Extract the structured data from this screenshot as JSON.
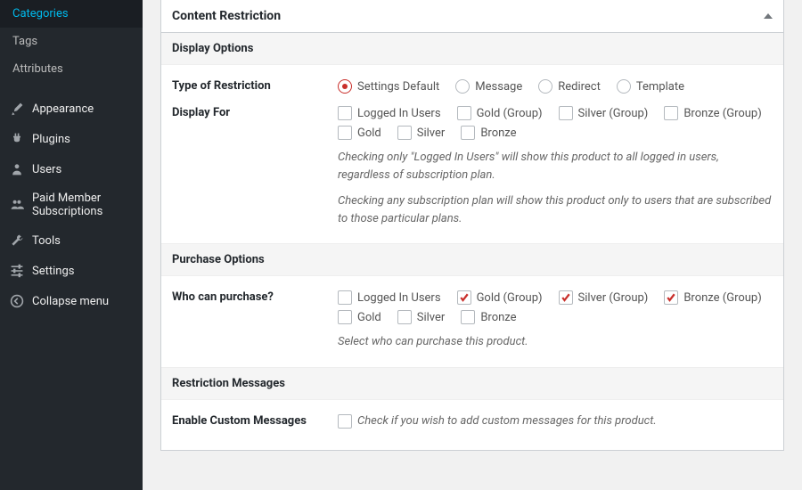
{
  "sidebar": {
    "items": [
      {
        "label": "Categories",
        "icon": null
      },
      {
        "label": "Tags",
        "icon": null
      },
      {
        "label": "Attributes",
        "icon": null
      },
      {
        "label": "Appearance",
        "icon": "brush"
      },
      {
        "label": "Plugins",
        "icon": "plug"
      },
      {
        "label": "Users",
        "icon": "user"
      },
      {
        "label": "Paid Member Subscriptions",
        "icon": "members"
      },
      {
        "label": "Tools",
        "icon": "wrench"
      },
      {
        "label": "Settings",
        "icon": "settings"
      },
      {
        "label": "Collapse menu",
        "icon": "collapse"
      }
    ]
  },
  "metabox": {
    "title": "Content Restriction",
    "sections": {
      "display_options": {
        "heading": "Display Options",
        "type_of_restriction": {
          "label": "Type of Restriction",
          "options": [
            "Settings Default",
            "Message",
            "Redirect",
            "Template"
          ],
          "selected": "Settings Default"
        },
        "display_for": {
          "label": "Display For",
          "options": [
            {
              "label": "Logged In Users",
              "checked": false
            },
            {
              "label": "Gold (Group)",
              "checked": false
            },
            {
              "label": "Silver (Group)",
              "checked": false
            },
            {
              "label": "Bronze (Group)",
              "checked": false
            },
            {
              "label": "Gold",
              "checked": false
            },
            {
              "label": "Silver",
              "checked": false
            },
            {
              "label": "Bronze",
              "checked": false
            }
          ],
          "help1": "Checking only \"Logged In Users\" will show this product to all logged in users, regardless of subscription plan.",
          "help2": "Checking any subscription plan will show this product only to users that are subscribed to those particular plans."
        }
      },
      "purchase_options": {
        "heading": "Purchase Options",
        "who_can_purchase": {
          "label": "Who can purchase?",
          "options": [
            {
              "label": "Logged In Users",
              "checked": false
            },
            {
              "label": "Gold (Group)",
              "checked": true
            },
            {
              "label": "Silver (Group)",
              "checked": true
            },
            {
              "label": "Bronze (Group)",
              "checked": true
            },
            {
              "label": "Gold",
              "checked": false
            },
            {
              "label": "Silver",
              "checked": false
            },
            {
              "label": "Bronze",
              "checked": false
            }
          ],
          "help": "Select who can purchase this product."
        }
      },
      "restriction_messages": {
        "heading": "Restriction Messages",
        "enable_custom": {
          "label": "Enable Custom Messages",
          "checked": false,
          "help": "Check if you wish to add custom messages for this product."
        }
      }
    }
  }
}
